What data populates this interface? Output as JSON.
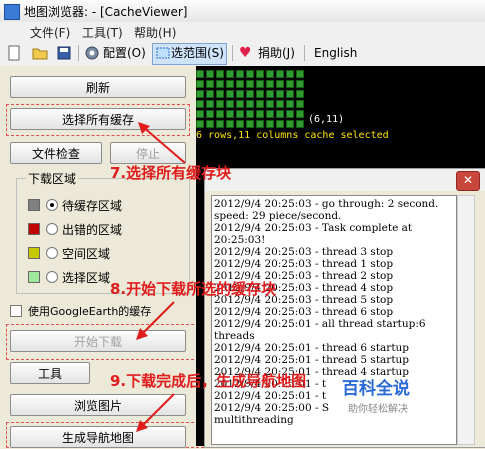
{
  "window": {
    "title": "地图浏览器: - [CacheViewer]"
  },
  "menu": {
    "items": [
      "文件(F)",
      "工具(T)",
      "帮助(H)"
    ]
  },
  "toolbar": {
    "config_label": "配置(O)",
    "select_range_label": "选范围(S)",
    "donate_label": "捐助(J)",
    "english_label": "English"
  },
  "left": {
    "refresh_label": "刷新",
    "select_all_cache_label": "选择所有缓存",
    "file_check_label": "文件检查",
    "stop_label": "停止",
    "download_area_label": "下载区域",
    "options": [
      {
        "label": "待缓存区域",
        "color": "#808080",
        "selected": true
      },
      {
        "label": "出错的区域",
        "color": "#c00000",
        "selected": false
      },
      {
        "label": "空间区域",
        "color": "#c8c800",
        "selected": false
      },
      {
        "label": "选择区域",
        "color": "#9ee89e",
        "selected": false
      }
    ],
    "google_earth_cache_label": "使用GoogleEarth的缓存",
    "start_download_label": "开始下载",
    "tools_label": "工具",
    "browse_images_label": "浏览图片",
    "generate_nav_map_label": "生成导航地图"
  },
  "map": {
    "coords_label": "(6,11)",
    "status_text": "6 rows,11 columns cache selected",
    "grid_rows": 6,
    "grid_cols": 11
  },
  "log": {
    "text": "2012/9/4 20:25:03 - go through: 2 second. speed: 29 piece/second.\n2012/9/4 20:25:03 - Task complete at 20:25:03!\n2012/9/4 20:25:03 - thread 3 stop\n2012/9/4 20:25:03 - thread 1 stop\n2012/9/4 20:25:03 - thread 2 stop\n2012/9/4 20:25:03 - thread 4 stop\n2012/9/4 20:25:03 - thread 5 stop\n2012/9/4 20:25:03 - thread 6 stop\n2012/9/4 20:25:01 - all thread startup:6 threads\n2012/9/4 20:25:01 - thread 6 startup\n2012/9/4 20:25:01 - thread 5 startup\n2012/9/4 20:25:01 - thread 4 startup\n2012/9/4 20:25:01 - t\n2012/9/4 20:25:01 - t\n2012/9/4 20:25:00 - S\nmultithreading"
  },
  "annotations": {
    "step7": "7.选择所有缓存块",
    "step8": "8.开始下载所选的缓存块",
    "step9": "9.下载完成后，生成导航地图"
  },
  "watermark": {
    "name": "百科全说",
    "slogan": "助你轻松解决"
  }
}
